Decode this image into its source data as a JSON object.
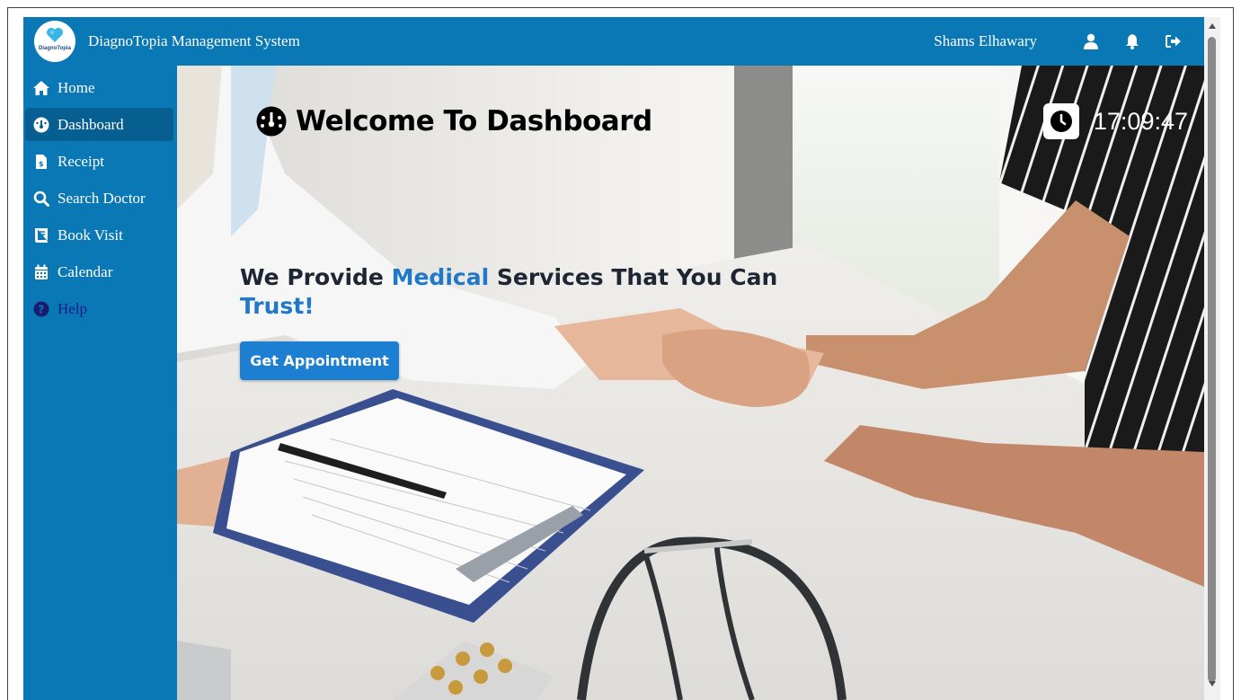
{
  "app": {
    "title": "DiagnoTopia Management System",
    "logo_text": "DiagnoTopia",
    "user_name": "Shams Elhawary"
  },
  "header": {
    "icons": [
      "user-icon",
      "bell-icon",
      "logout-icon"
    ]
  },
  "sidebar": {
    "items": [
      {
        "label": "Home",
        "icon": "home-icon"
      },
      {
        "label": "Dashboard",
        "icon": "dashboard-icon",
        "active": true
      },
      {
        "label": "Receipt",
        "icon": "receipt-icon"
      },
      {
        "label": "Search Doctor",
        "icon": "search-icon"
      },
      {
        "label": "Book Visit",
        "icon": "book-icon"
      },
      {
        "label": "Calendar",
        "icon": "calendar-icon"
      },
      {
        "label": "Help",
        "icon": "help-icon"
      }
    ]
  },
  "main": {
    "welcome": "Welcome To Dashboard",
    "clock": "17:09:47",
    "tagline_part1": "We Provide ",
    "tagline_highlight1": "Medical",
    "tagline_part2": " Services That You Can ",
    "tagline_highlight2": "Trust!",
    "cta_label": "Get Appointment"
  },
  "colors": {
    "brand": "#0a78b4",
    "accent": "#1f78c8",
    "button": "#1c7fd1"
  }
}
